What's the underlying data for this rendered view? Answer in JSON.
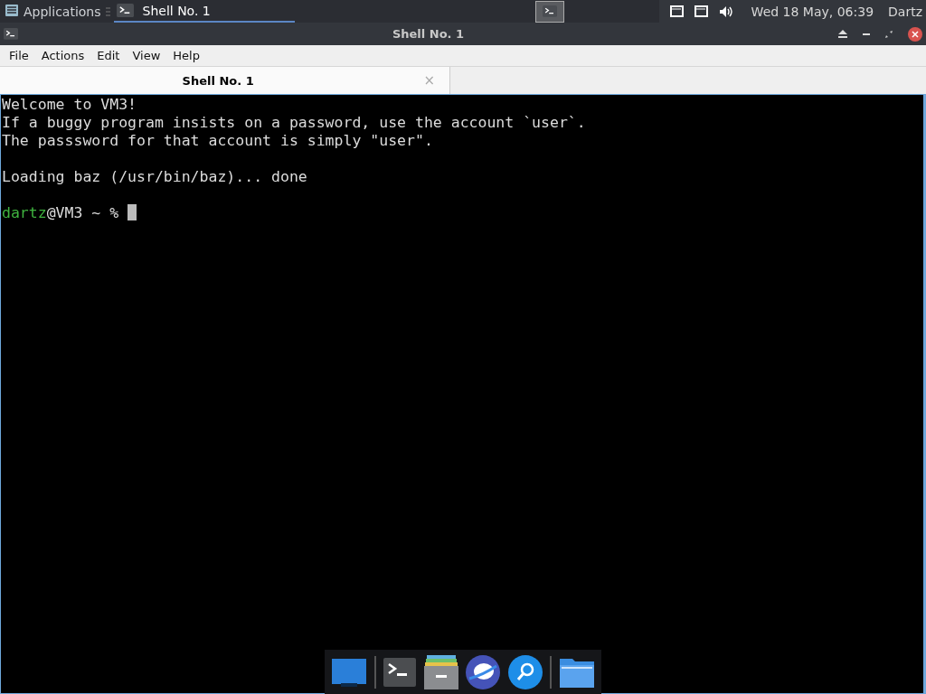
{
  "top_panel": {
    "menu_label": "Applications",
    "tasks": [
      {
        "label": "Shell No. 1",
        "selected": true
      }
    ],
    "clock": "Wed 18 May, 06:39",
    "user": "Dartz"
  },
  "window": {
    "title": "Shell No. 1"
  },
  "menu": [
    "File",
    "Actions",
    "Edit",
    "View",
    "Help"
  ],
  "tabs": [
    {
      "label": "Shell No. 1",
      "selected": true,
      "close": "×"
    }
  ],
  "terminal": {
    "lines": [
      {
        "kind": "text",
        "text": "Welcome to VM3!"
      },
      {
        "kind": "text",
        "text": "If a buggy program insists on a password, use the account `user`."
      },
      {
        "kind": "text",
        "text": "The passsword for that account is simply \"user\"."
      },
      {
        "kind": "blank"
      },
      {
        "kind": "text",
        "text": "Loading baz (/usr/bin/baz)... done"
      },
      {
        "kind": "blank"
      },
      {
        "kind": "prompt",
        "user": "dartz",
        "text": "@VM3 ~ %"
      }
    ]
  }
}
